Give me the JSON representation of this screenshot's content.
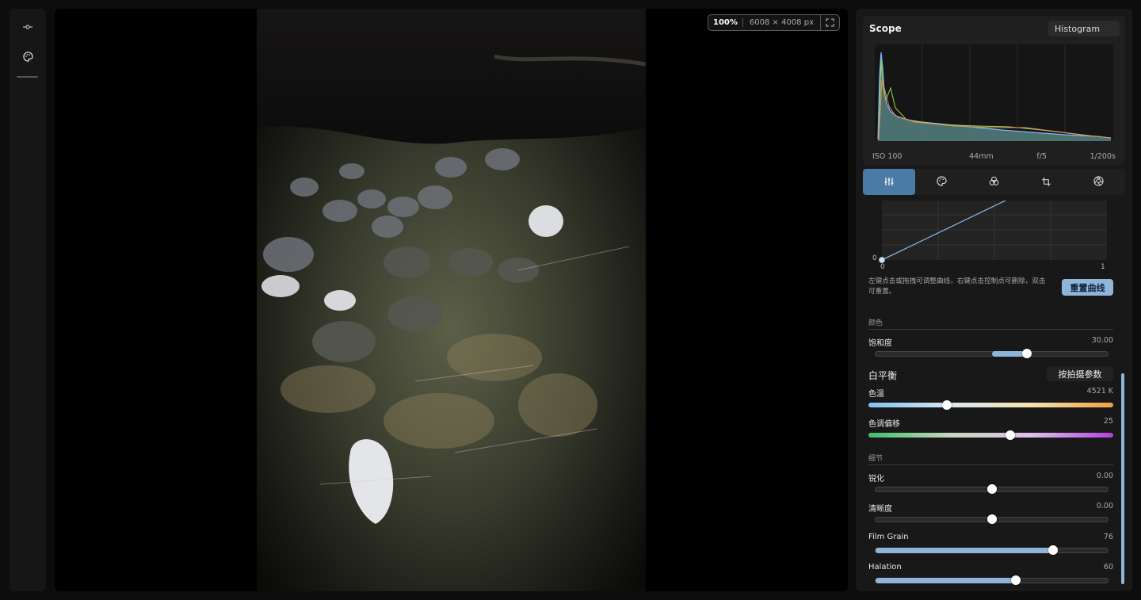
{
  "rail": {
    "icons": [
      "adjust-slider-icon",
      "palette-icon"
    ]
  },
  "canvas": {
    "zoom": "100%",
    "dimensions": "6008 × 4008 px"
  },
  "scope": {
    "title": "Scope",
    "mode": "Histogram",
    "exif": {
      "iso": "ISO 100",
      "focal": "44mm",
      "aperture": "f/5",
      "shutter": "1/200s"
    }
  },
  "tabs": [
    {
      "icon": "sliders-icon",
      "active": true
    },
    {
      "icon": "palette-icon",
      "active": false
    },
    {
      "icon": "color-circles-icon",
      "active": false
    },
    {
      "icon": "crop-icon",
      "active": false
    },
    {
      "icon": "aperture-icon",
      "active": false
    }
  ],
  "curve": {
    "axis_y_zero": "0",
    "axis_x_zero": "0",
    "axis_x_one": "1",
    "hint": "左键点击或拖拽可调整曲线，右键点击控制点可删除，双击可重置。",
    "reset_label": "重置曲线"
  },
  "color": {
    "section": "颜色",
    "saturation": {
      "label": "饱和度",
      "value": "30.00",
      "level": 0.65
    }
  },
  "white_balance": {
    "title": "白平衡",
    "as_shot_label": "按拍摄参数",
    "temperature": {
      "label": "色温",
      "value": "4521 K",
      "level": 0.32
    },
    "tint": {
      "label": "色调偏移",
      "value": "25",
      "level": 0.58
    }
  },
  "detail": {
    "section": "细节",
    "sharpen": {
      "label": "锐化",
      "value": "0.00",
      "level": 0.5
    },
    "clarity": {
      "label": "清晰度",
      "value": "0.00",
      "level": 0.5
    },
    "film_grain": {
      "label": "Film Grain",
      "value": "76",
      "level": 0.76
    },
    "halation": {
      "label": "Halation",
      "value": "60",
      "level": 0.6
    }
  },
  "colors": {
    "accent": "#8fb6d9",
    "tab_active": "#4a7aa6"
  }
}
